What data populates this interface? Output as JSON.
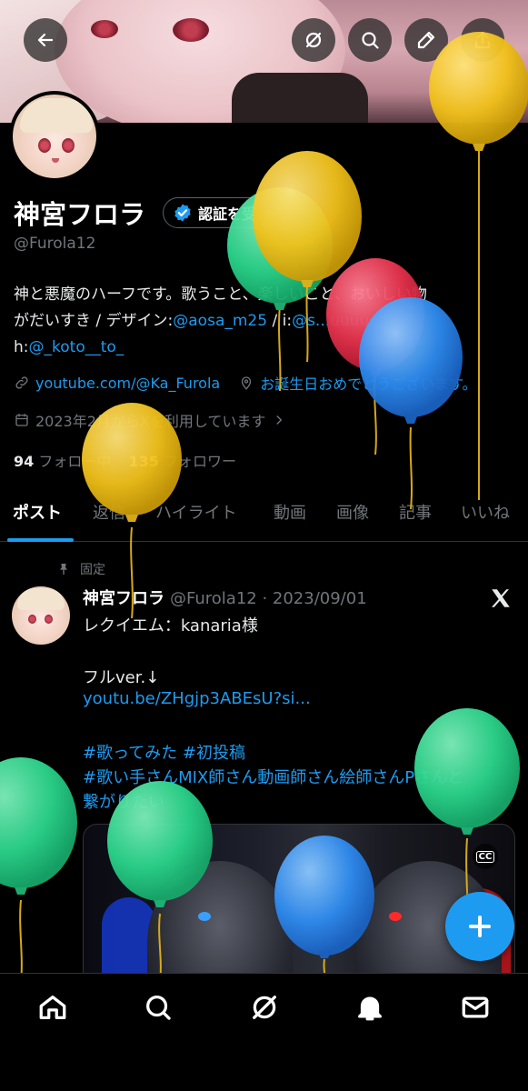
{
  "header": {
    "back_icon": "arrow-left-icon",
    "actions": [
      "grok-icon",
      "search-icon",
      "edit-icon",
      "share-icon"
    ]
  },
  "profile": {
    "display_name": "神宮フロラ",
    "verify_button": "認証を受ける",
    "handle": "@Furola12",
    "bio": {
      "line1": "神と悪魔のハーフです。歌うこと、楽しいこと、おいしい物",
      "line2_prefix": "がだいすき / デザイン:",
      "line2_link1": "@aosa_m25",
      "line2_sep": " / i:",
      "line2_link2": "@s...uuuuuuu",
      "line2_suffix": " /",
      "line3_prefix": "h:",
      "line3_link": "@_koto__to_"
    },
    "website": "youtube.com/@Ka_Furola",
    "location": "お誕生日おめでとうございます。",
    "joined": "2023年2月からXを利用しています",
    "following_count": "94",
    "following_label": "フォロー中",
    "followers_count": "135",
    "followers_label": "フォロワー"
  },
  "tabs": [
    "ポスト",
    "返信",
    "ハイライト",
    "動画",
    "画像",
    "記事",
    "いいね"
  ],
  "post": {
    "pinned_label": "固定",
    "author": "神宮フロラ",
    "meta": "@Furola12 · 2023/09/01",
    "lines": [
      {
        "text": "レクイエム：kanaria様",
        "link": false
      },
      {
        "text": "フルver.↓",
        "link": false
      },
      {
        "text": "youtu.be/ZHgjp3ABEsU?si...",
        "link": true
      },
      {
        "text": "#歌ってみた  #初投稿",
        "link": true
      },
      {
        "text": "#歌い手さんMIX師さん動画師さん絵師さんPさんと",
        "link": true
      },
      {
        "text": "繋がりたい",
        "link": true
      }
    ],
    "cc_label": "CC"
  },
  "bottom_nav": [
    "home-icon",
    "search-icon",
    "grok-icon",
    "notifications-icon",
    "messages-icon"
  ],
  "colors": {
    "accent": "#1d9bf0",
    "balloon_yellow": "#f2c21b",
    "balloon_green": "#2bd68c",
    "balloon_red": "#e8344e",
    "balloon_blue": "#2f8cf0"
  }
}
